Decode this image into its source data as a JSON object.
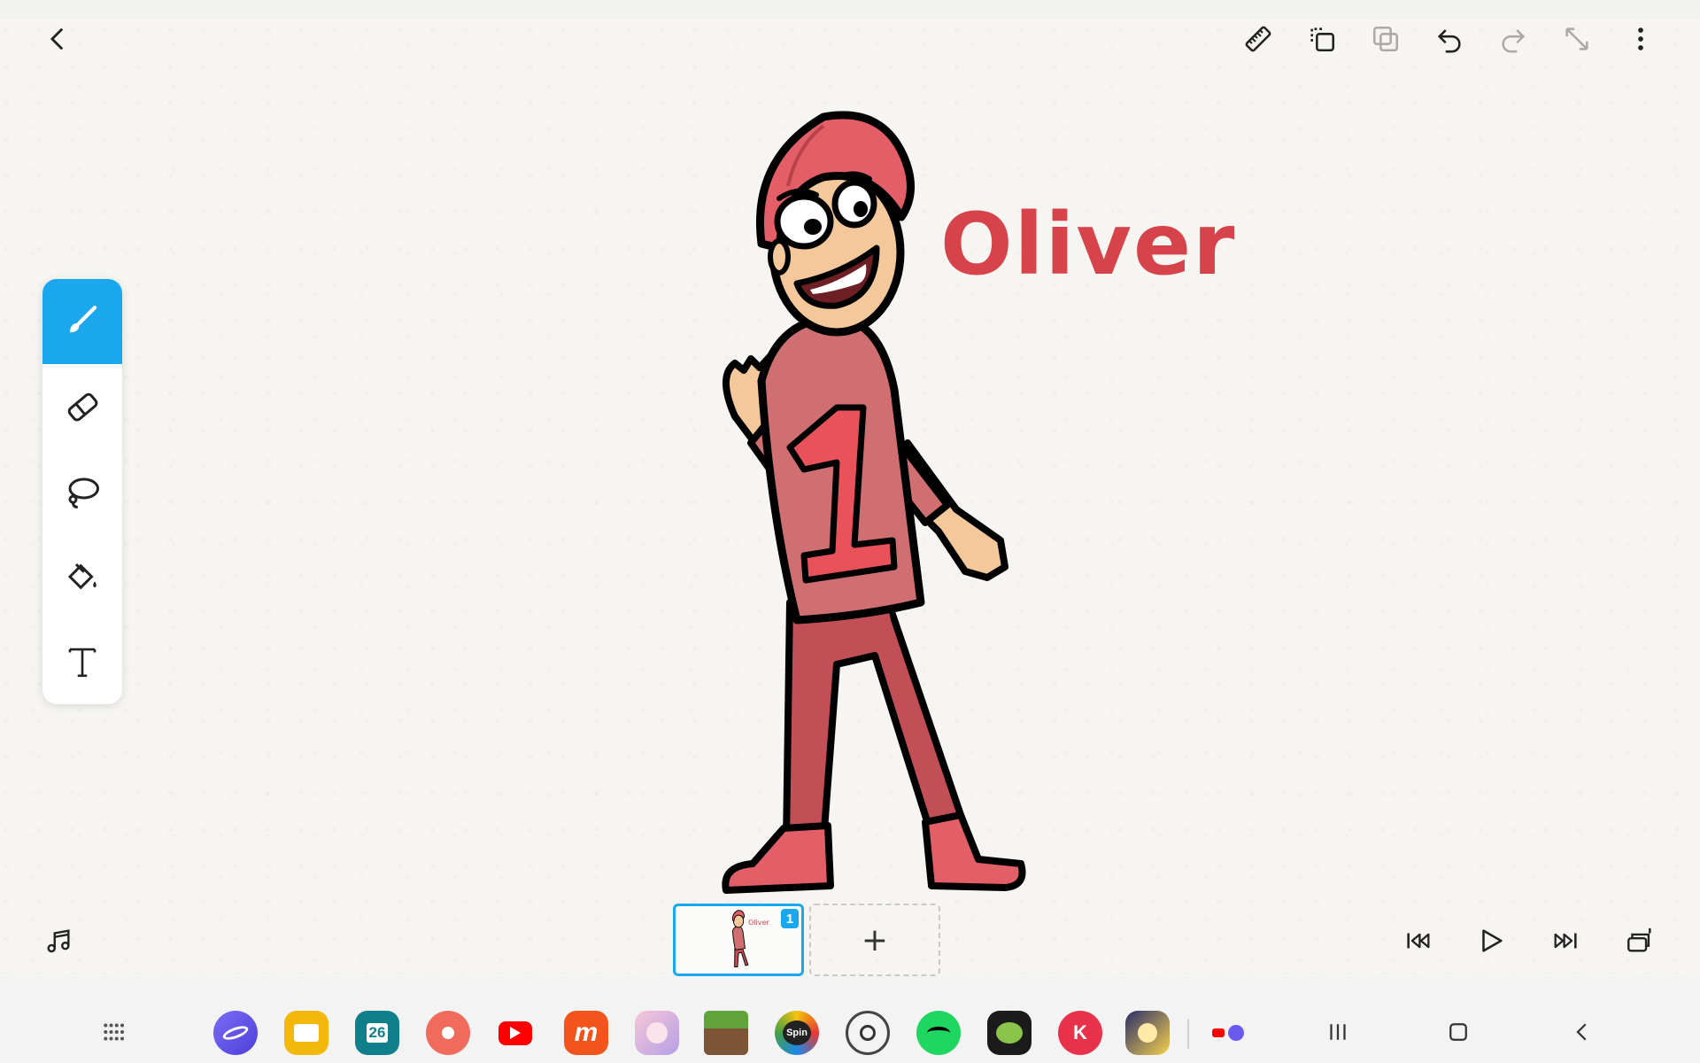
{
  "canvas": {
    "drawing_text": "Oliver",
    "frame_number": "1",
    "thumb_text": "Oliver"
  },
  "toolbar": {
    "add_frame_label": "+"
  },
  "taskbar": {
    "calendar_day": "26",
    "spin_label": "Spin",
    "mobizen_letter": "m",
    "kinemaster_letter": "K"
  },
  "colors": {
    "accent": "#1aa7ee",
    "label_red": "#d7434b",
    "shirt": "#cf6f72",
    "pants": "#c14f55"
  }
}
